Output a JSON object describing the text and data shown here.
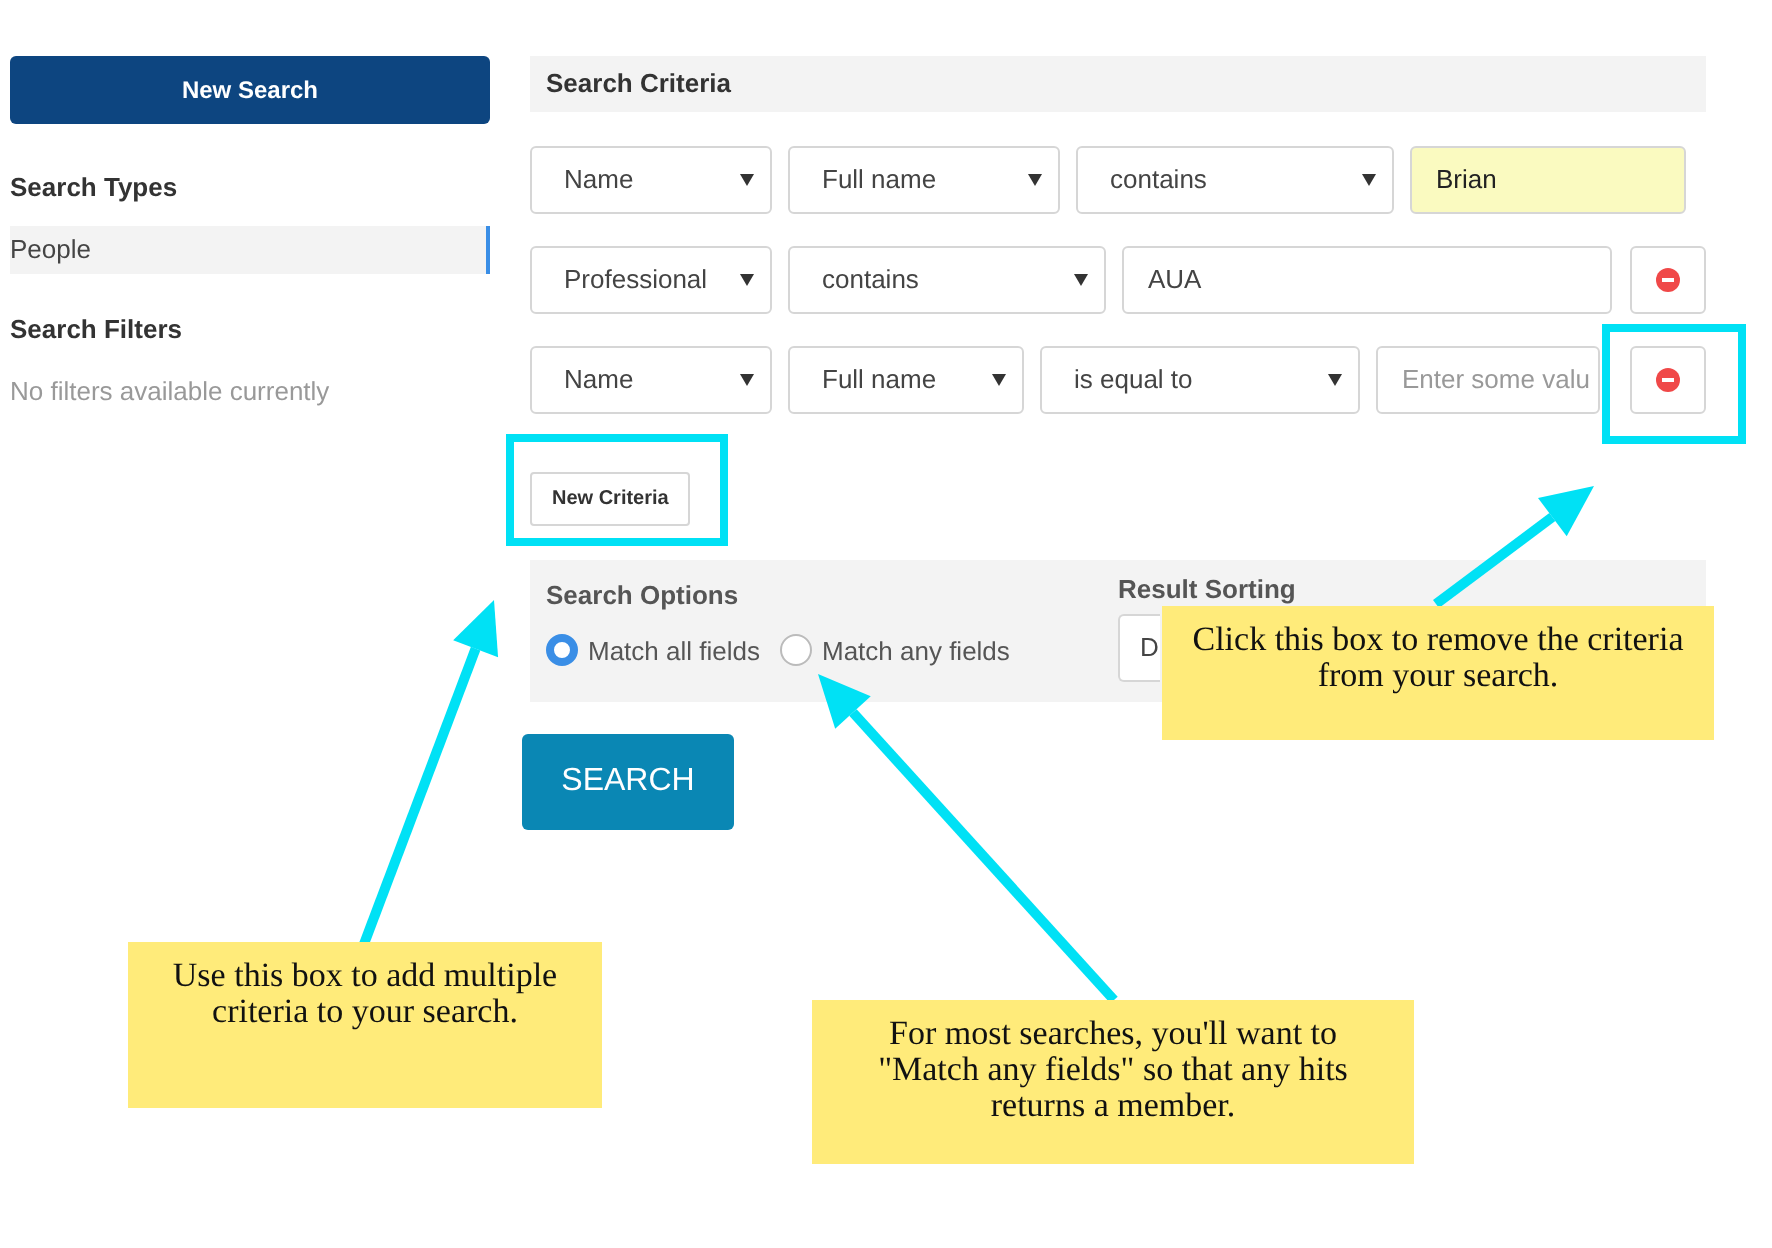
{
  "sidebar": {
    "new_search_button": "New Search",
    "search_types_heading": "Search Types",
    "search_types": [
      {
        "label": "People",
        "selected": true
      }
    ],
    "filters_heading": "Search Filters",
    "filters_empty": "No filters available currently"
  },
  "criteria": {
    "title": "Search Criteria",
    "rows": [
      {
        "controls": [
          {
            "kind": "select",
            "value": "Name"
          },
          {
            "kind": "select",
            "value": "Full name"
          },
          {
            "kind": "select",
            "value": "contains"
          },
          {
            "kind": "field",
            "value": "Brian",
            "highlighted": true
          }
        ],
        "removable": false
      },
      {
        "controls": [
          {
            "kind": "select",
            "value": "Professional"
          },
          {
            "kind": "select",
            "value": "contains"
          },
          {
            "kind": "field",
            "value": "AUA",
            "highlighted": false
          }
        ],
        "removable": true
      },
      {
        "controls": [
          {
            "kind": "select",
            "value": "Name"
          },
          {
            "kind": "select",
            "value": "Full name"
          },
          {
            "kind": "select",
            "value": "is equal to"
          },
          {
            "kind": "field",
            "placeholder": "Enter some valu",
            "highlighted": false
          }
        ],
        "removable": true
      }
    ],
    "new_criteria_button": "New Criteria"
  },
  "search_options": {
    "heading": "Search Options",
    "options": [
      {
        "label": "Match all fields",
        "selected": true
      },
      {
        "label": "Match any fields",
        "selected": false
      }
    ]
  },
  "result_sorting": {
    "heading": "Result Sorting",
    "value": "D"
  },
  "search_button": "SEARCH",
  "annotations": [
    {
      "text": "Click this box to remove the criteria from your search."
    },
    {
      "text": "Use this box to add multiple criteria to your search."
    },
    {
      "text": "For most searches, you'll want to \"Match any fields\" so that any hits returns a member."
    }
  ]
}
